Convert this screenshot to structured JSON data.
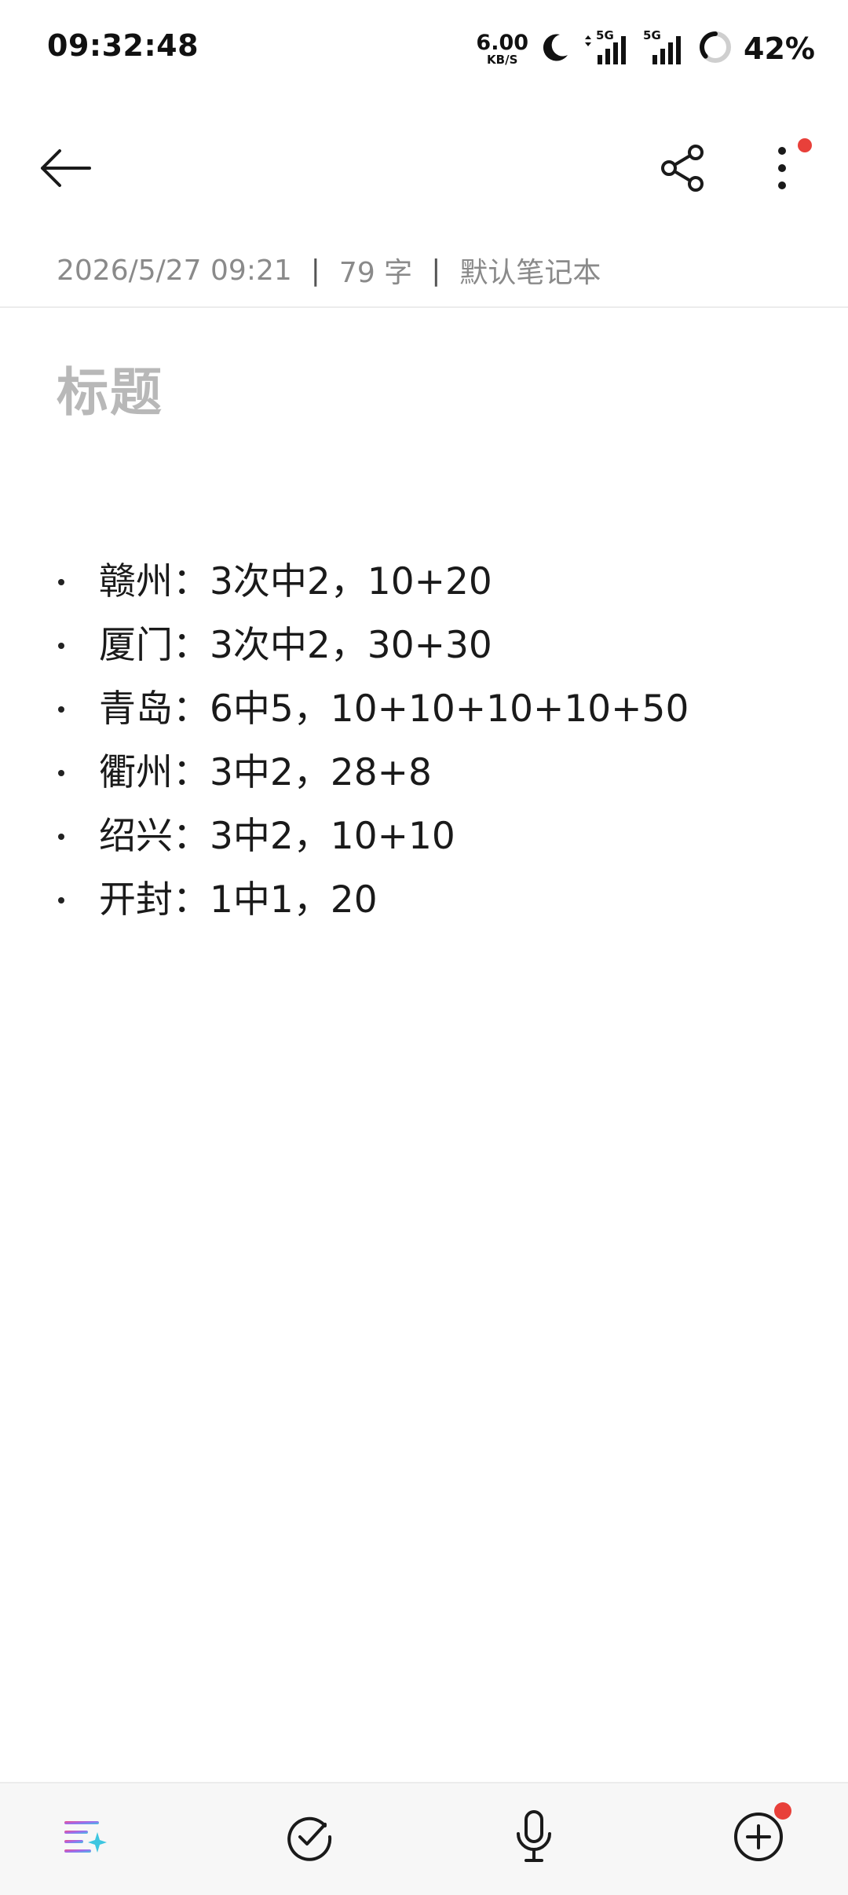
{
  "status_bar": {
    "time": "09:32:48",
    "net_speed_value": "6.00",
    "net_speed_unit": "KB/S",
    "sim1_label": "5G",
    "sim2_label": "5G",
    "battery_percent": "42%",
    "battery_level": 0.42
  },
  "toolbar": {
    "back_icon": "arrow-left-icon",
    "share_icon": "share-icon",
    "more_icon": "more-vertical-icon",
    "more_has_badge": true,
    "badge_color": "#e8403a"
  },
  "meta": {
    "datetime": "2026/5/27 09:21",
    "separator": "|",
    "word_count": "79 字",
    "notebook": "默认笔记本"
  },
  "note": {
    "title_placeholder": "标题",
    "items": [
      "赣州：3次中2，10+20",
      "厦门：3次中2，30+30",
      "青岛：6中5，10+10+10+10+50",
      "衢州：3中2，28+8",
      "绍兴：3中2，10+10",
      "开封：1中1，20"
    ]
  },
  "bottom_bar": {
    "format_icon": "ai-format-icon",
    "checklist_icon": "check-circle-icon",
    "voice_icon": "microphone-icon",
    "add_icon": "add-circle-icon",
    "add_has_badge": true
  },
  "colors": {
    "meta_text": "#8a8a8a",
    "title_placeholder": "#b8b8b8",
    "badge": "#e8403a"
  }
}
